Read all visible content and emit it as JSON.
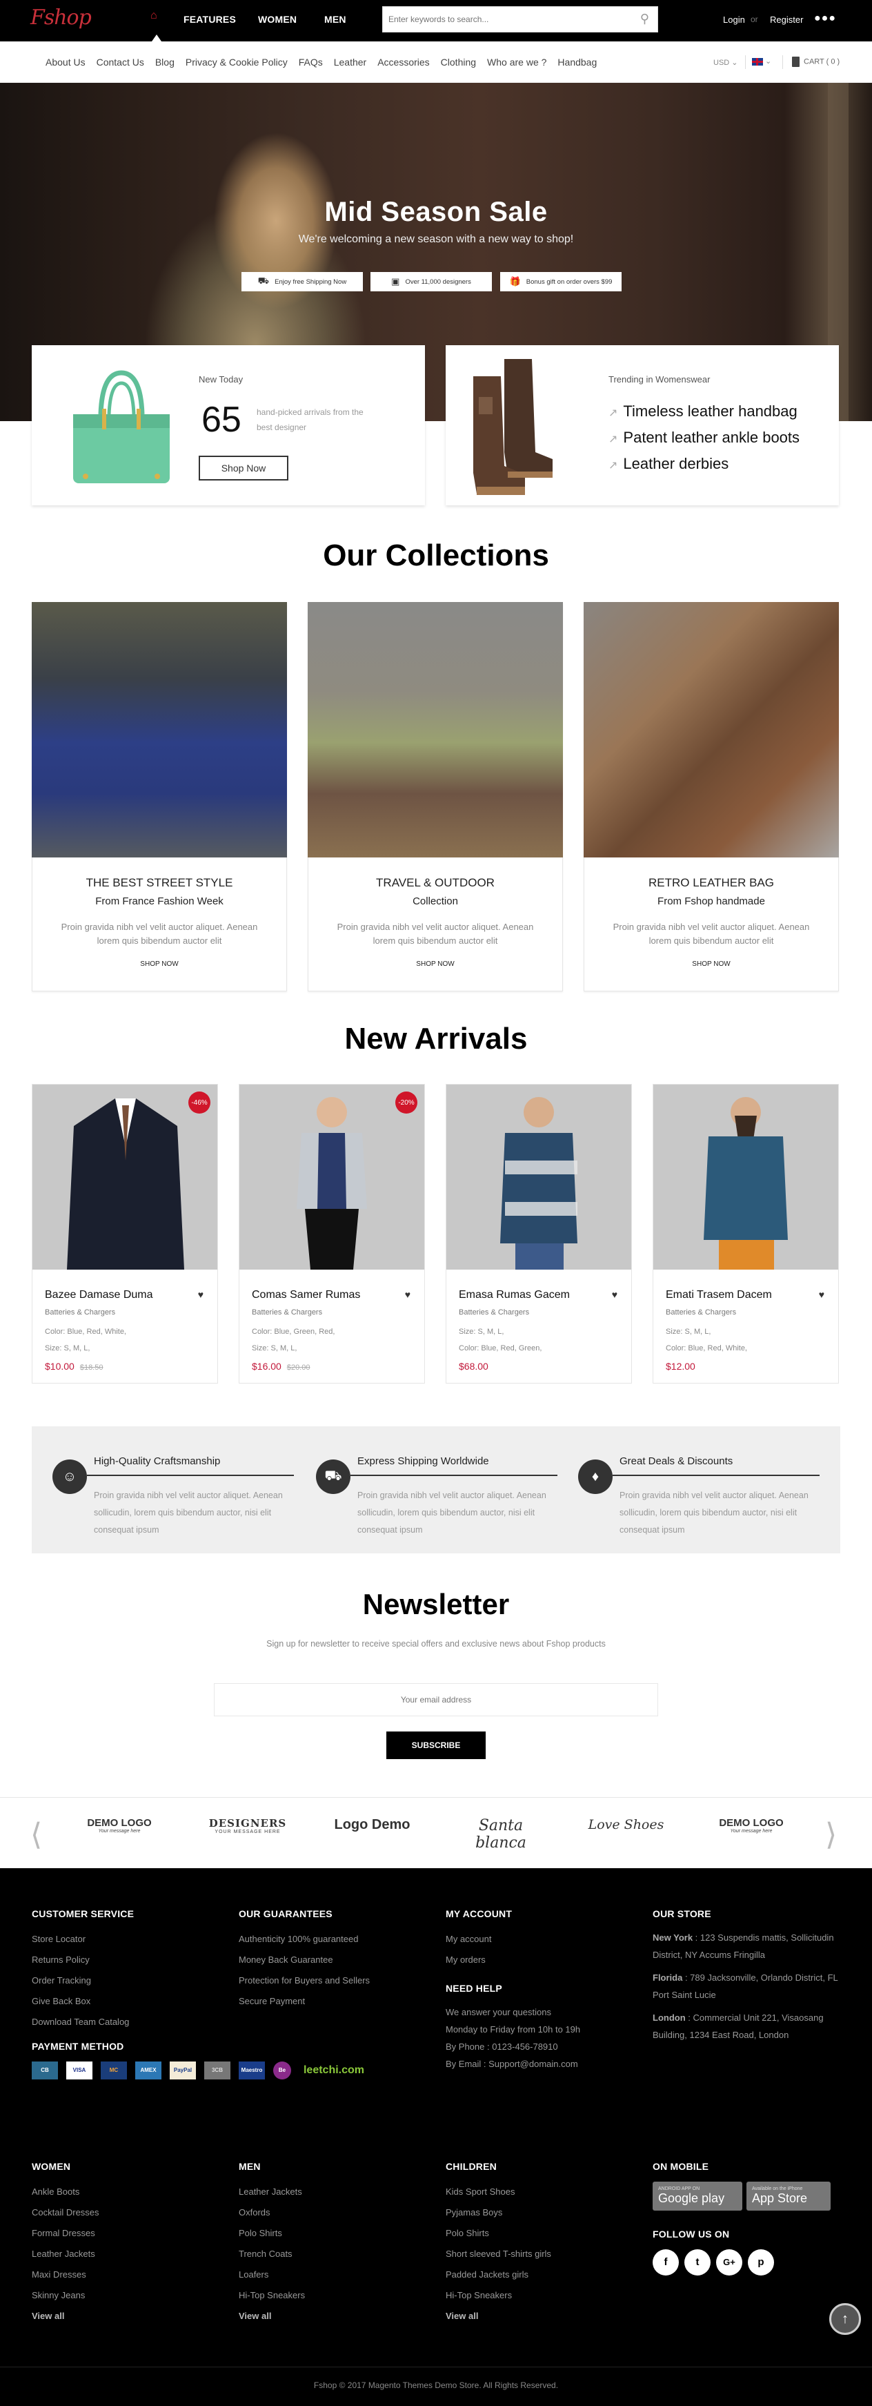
{
  "header": {
    "logo": "Fshop",
    "nav": [
      "FEATURES",
      "WOMEN",
      "MEN"
    ],
    "search_placeholder": "Enter keywords to search...",
    "login": "Login",
    "or": "or",
    "register": "Register",
    "more": "●●●"
  },
  "subnav": {
    "items": [
      "About Us",
      "Contact Us",
      "Blog",
      "Privacy & Cookie Policy",
      "FAQs",
      "Leather",
      "Accessories",
      "Clothing",
      "Who are we ?",
      "Handbag"
    ],
    "currency": "USD",
    "cart": "CART ( 0 )"
  },
  "hero": {
    "title": "Mid Season Sale",
    "subtitle": "We're welcoming a new season with a new way to shop!",
    "badges": [
      "Enjoy  free Shipping Now",
      "Over 11,000 designers",
      "Bonus gift on order overs $99"
    ]
  },
  "promo": {
    "new_today": "New Today",
    "count": "65",
    "count_desc": "hand-picked arrivals from the best designer",
    "shop_now": "Shop Now",
    "trending_title": "Trending in Womenswear",
    "trending": [
      "Timeless leather handbag",
      "Patent leather ankle boots",
      "Leather derbies"
    ]
  },
  "collections": {
    "title": "Our Collections",
    "items": [
      {
        "title": "THE BEST STREET STYLE",
        "subtitle": "From France Fashion Week",
        "text": "Proin gravida nibh vel velit auctor aliquet. Aenean lorem quis bibendum auctor elit",
        "cta": "SHOP NOW"
      },
      {
        "title": "TRAVEL & OUTDOOR",
        "subtitle": "Collection",
        "text": "Proin gravida nibh vel velit auctor aliquet. Aenean lorem quis bibendum auctor elit",
        "cta": "SHOP NOW"
      },
      {
        "title": "RETRO LEATHER BAG",
        "subtitle": "From Fshop handmade",
        "text": "Proin gravida nibh vel velit auctor aliquet. Aenean lorem quis bibendum auctor elit",
        "cta": "SHOP NOW"
      }
    ]
  },
  "arrivals": {
    "title": "New Arrivals",
    "products": [
      {
        "name": "Bazee Damase Duma",
        "category": "Batteries & Chargers",
        "line1": "Color: Blue, Red, White,",
        "line2": "Size: S, M, L,",
        "price": "$10.00",
        "old_price": "$18.50",
        "sale": "-46%"
      },
      {
        "name": "Comas Samer Rumas",
        "category": "Batteries & Chargers",
        "line1": "Color: Blue, Green, Red,",
        "line2": "Size: S, M, L,",
        "price": "$16.00",
        "old_price": "$20.00",
        "sale": "-20%"
      },
      {
        "name": "Emasa Rumas Gacem",
        "category": "Batteries & Chargers",
        "line1": "Size: S, M, L,",
        "line2": "Color: Blue, Red, Green,",
        "price": "$68.00",
        "old_price": null,
        "sale": null
      },
      {
        "name": "Emati Trasem Dacem",
        "category": "Batteries & Chargers",
        "line1": "Size: S, M, L,",
        "line2": "Color: Blue, Red, White,",
        "price": "$12.00",
        "old_price": null,
        "sale": null
      }
    ]
  },
  "features": [
    {
      "title": "High-Quality Craftsmanship",
      "icon": "smiley-icon",
      "text": "Proin gravida nibh vel velit auctor aliquet. Aenean sollicudin, lorem quis bibendum auctor, nisi elit consequat ipsum"
    },
    {
      "title": "Express Shipping Worldwide",
      "icon": "truck-icon",
      "text": "Proin gravida nibh vel velit auctor aliquet. Aenean sollicudin, lorem quis bibendum auctor, nisi elit consequat ipsum"
    },
    {
      "title": "Great Deals & Discounts",
      "icon": "tag-icon",
      "text": "Proin gravida nibh vel velit auctor aliquet. Aenean sollicudin, lorem quis bibendum auctor, nisi elit consequat ipsum"
    }
  ],
  "newsletter": {
    "title": "Newsletter",
    "subtitle": "Sign up for newsletter to receive special offers and exclusive news about Fshop products",
    "placeholder": "Your email address",
    "button": "SUBSCRIBE"
  },
  "brands": [
    {
      "big": "DEMO LOGO",
      "small": "Your message here"
    },
    {
      "big": "DESIGNERS",
      "small": "YOUR MESSAGE HERE"
    },
    {
      "big": "Logo Demo",
      "small": ""
    },
    {
      "big": "Santa blanca",
      "small": ""
    },
    {
      "big": "Love Shoes",
      "small": ""
    },
    {
      "big": "DEMO LOGO",
      "small": "Your message here"
    }
  ],
  "footer": {
    "customer_service": {
      "title": "CUSTOMER SERVICE",
      "links": [
        "Store Locator",
        "Returns Policy",
        "Order Tracking",
        "Give Back Box",
        "Download Team Catalog"
      ]
    },
    "guarantees": {
      "title": "OUR GUARANTEES",
      "links": [
        "Authenticity 100% guaranteed",
        "Money Back Guarantee",
        "Protection for Buyers and Sellers",
        "Secure Payment"
      ]
    },
    "account": {
      "title": "MY ACCOUNT",
      "links": [
        "My account",
        "My orders"
      ]
    },
    "help": {
      "title": "NEED HELP",
      "lines": [
        "We answer your questions",
        "Monday to Friday from 10h to 19h",
        "By Phone : 0123-456-78910",
        "By Email : Support@domain.com"
      ]
    },
    "store": {
      "title": "OUR STORE",
      "locations": [
        {
          "city": "New York",
          "address": " : 123 Suspendis mattis, Sollicitudin District, NY Accums Fringilla"
        },
        {
          "city": "Florida",
          "address": " : 789 Jacksonville, Orlando District, FL Port Saint Lucie"
        },
        {
          "city": "London",
          "address": " : Commercial Unit 221, Visaosang Building, 1234 East Road, London"
        }
      ]
    },
    "payment": {
      "title": "PAYMENT METHOD",
      "methods": [
        "CB",
        "VISA",
        "MasterCard",
        "AMEX",
        "PayPal",
        "JCB",
        "Maestro",
        "Be Smart",
        "leetchi.com"
      ]
    },
    "women": {
      "title": "WOMEN",
      "links": [
        "Ankle Boots",
        "Cocktail Dresses",
        "Formal Dresses",
        "Leather Jackets",
        "Maxi Dresses",
        "Skinny Jeans"
      ],
      "view_all": "View all"
    },
    "men": {
      "title": "MEN",
      "links": [
        "Leather Jackets",
        "Oxfords",
        "Polo Shirts",
        "Trench Coats",
        "Loafers",
        "Hi-Top Sneakers"
      ],
      "view_all": "View all"
    },
    "children": {
      "title": "CHILDREN",
      "links": [
        "Kids Sport Shoes",
        "Pyjamas Boys",
        "Polo Shirts",
        "Short sleeved T-shirts girls",
        "Padded Jackets girls",
        "Hi-Top Sneakers"
      ],
      "view_all": "View all"
    },
    "mobile": {
      "title": "ON MOBILE",
      "google_small": "ANDROID APP ON",
      "google": "Google play",
      "apple_small": "Available on the iPhone",
      "apple": "App Store"
    },
    "follow": {
      "title": "FOLLOW US ON",
      "networks": [
        "f",
        "t",
        "G+",
        "p"
      ]
    },
    "copyright": "Fshop © 2017 Magento Themes Demo Store. All Rights Reserved."
  },
  "colors": {
    "accent": "#d0162a",
    "price": "#c2183a",
    "footer_bg": "#000000",
    "topbar_bg": "#000000"
  }
}
